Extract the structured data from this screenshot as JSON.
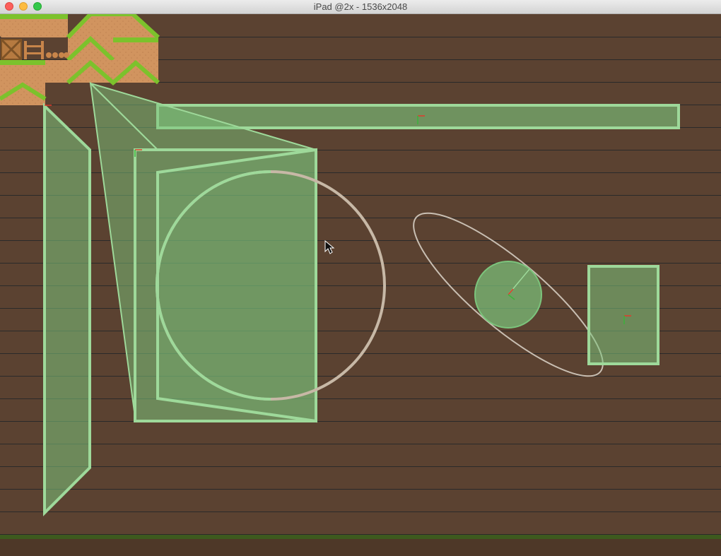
{
  "window": {
    "title": "iPad @2x - 1536x2048",
    "buttons": [
      "close",
      "minimize",
      "zoom"
    ]
  },
  "scene": {
    "background_color": "#5b4231",
    "stripe_color": "#2a2a2a",
    "physics_fill": "#7cc47c",
    "physics_stroke": "#9ed99a",
    "ellipse_stroke": "#c9bfb3",
    "ground_color": "#3d5a1e",
    "tileset": {
      "dirt_color": "#d1945f",
      "grass_color": "#7cc22c",
      "crate_color": "#b67a40",
      "fence_color": "#c8854a"
    },
    "physics_bodies": [
      {
        "name": "long-horizontal-box",
        "shape": "rectangle"
      },
      {
        "name": "tall-parallelogram",
        "shape": "polygon"
      },
      {
        "name": "large-quad-triangle",
        "shape": "polygon"
      },
      {
        "name": "large-circle-outline",
        "shape": "circle"
      },
      {
        "name": "rotated-ellipse",
        "shape": "ellipse"
      },
      {
        "name": "small-circle",
        "shape": "circle"
      },
      {
        "name": "small-box",
        "shape": "rectangle"
      }
    ],
    "cursor_icon": "arrow-cursor-icon"
  }
}
